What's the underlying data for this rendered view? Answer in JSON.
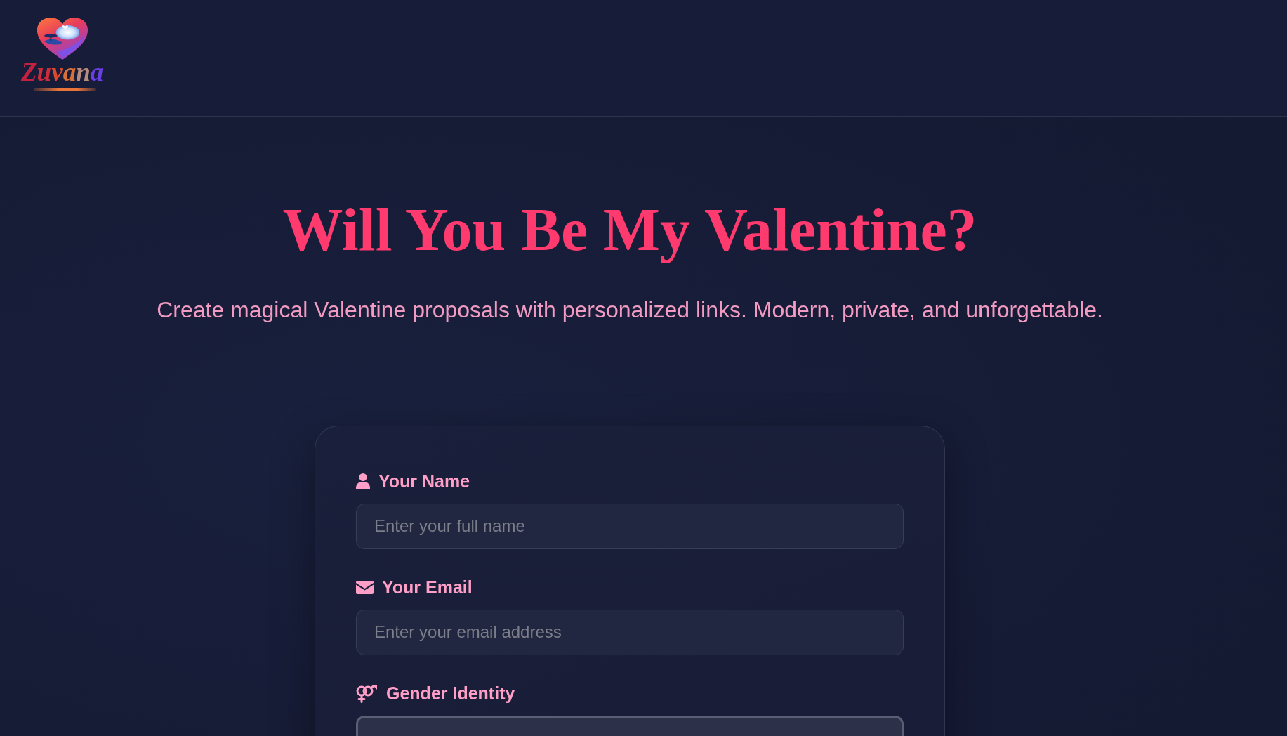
{
  "header": {
    "brand": {
      "name": "Zuvana"
    }
  },
  "hero": {
    "title": "Will You Be My Valentine?",
    "subtitle": "Create magical Valentine proposals with personalized links. Modern, private, and unforgettable."
  },
  "form": {
    "fields": [
      {
        "kind": "text",
        "label": "Your Name",
        "placeholder": "Enter your full name"
      },
      {
        "kind": "email",
        "label": "Your Email",
        "placeholder": "Enter your email address"
      },
      {
        "kind": "select",
        "label": "Gender Identity"
      }
    ]
  }
}
